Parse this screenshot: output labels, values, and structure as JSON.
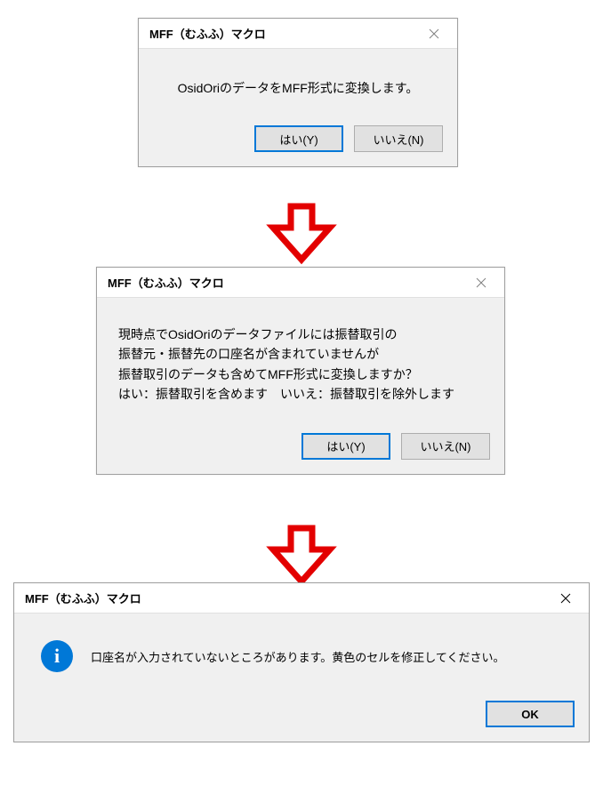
{
  "dialog1": {
    "title": "MFF（むふふ）マクロ",
    "message": "OsidOriのデータをMFF形式に変換します。",
    "yes_label": "はい(Y)",
    "no_label": "いいえ(N)"
  },
  "dialog2": {
    "title": "MFF（むふふ）マクロ",
    "message": "現時点でOsidOriのデータファイルには振替取引の\n振替元・振替先の口座名が含まれていませんが\n振替取引のデータも含めてMFF形式に変換しますか？\nはい：振替取引を含めます　いいえ：振替取引を除外します",
    "yes_label": "はい(Y)",
    "no_label": "いいえ(N)"
  },
  "dialog3": {
    "title": "MFF（むふふ）マクロ",
    "info_glyph": "i",
    "message": "口座名が入力されていないところがあります。黄色のセルを修正してください。",
    "ok_label": "OK"
  },
  "colors": {
    "arrow_stroke": "#e30000",
    "accent": "#0078d7"
  }
}
